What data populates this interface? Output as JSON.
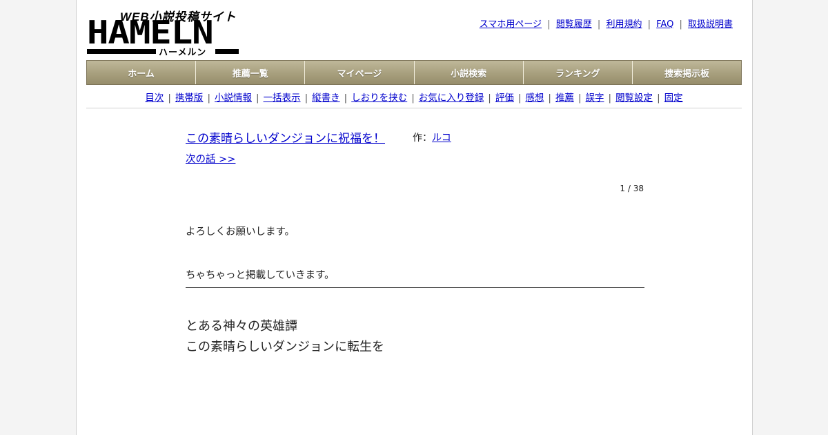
{
  "header": {
    "tagline": "WEB小説投稿サイト",
    "wordmark": "HAMELN",
    "kana": "ハーメルン",
    "links": [
      "スマホ用ページ",
      "閲覧履歴",
      "利用規約",
      "FAQ",
      "取扱説明書"
    ],
    "separator": "|"
  },
  "mainnav": {
    "items": [
      "ホーム",
      "推薦一覧",
      "マイページ",
      "小説検索",
      "ランキング",
      "捜索掲示板"
    ]
  },
  "subnav": {
    "items": [
      "目次",
      "携帯版",
      "小説情報",
      "一括表示",
      "縦書き",
      "しおりを挟む",
      "お気に入り登録",
      "評価",
      "感想",
      "推薦",
      "誤字",
      "閲覧設定",
      "固定"
    ],
    "separator": "|"
  },
  "novel": {
    "title": "この素晴らしいダンジョンに祝福を！",
    "author_prefix": "作：",
    "author": "ルコ",
    "next_link": "次の話 >>",
    "page_count": "1 / 38",
    "preface": [
      "よろしくお願いします。",
      "ちゃちゃっと掲載していきます。"
    ],
    "chapter_lines": [
      "とある神々の英雄譚",
      "この素晴らしいダンジョンに転生を"
    ]
  },
  "colors": {
    "link": "#0000cc",
    "nav_gradient_top": "#bfb89a",
    "nav_gradient_bottom": "#968d6b",
    "nav_text": "#ffffff",
    "page_background": "#f4f4f4"
  }
}
